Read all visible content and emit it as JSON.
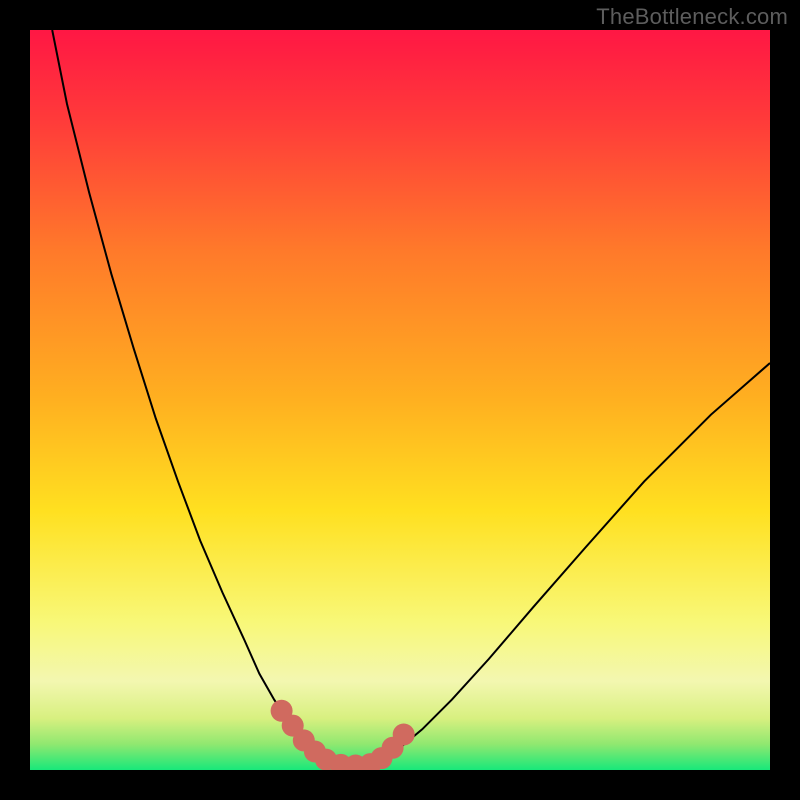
{
  "watermark": "TheBottleneck.com",
  "chart_data": {
    "type": "line",
    "title": "",
    "xlabel": "",
    "ylabel": "",
    "xlim": [
      0,
      100
    ],
    "ylim": [
      0,
      100
    ],
    "grid": false,
    "legend": false,
    "annotations": [],
    "background": {
      "type": "vertical-gradient",
      "description": "red-orange-yellow-green gradient signifying bottleneck severity (red=high, green=low)",
      "stops": [
        {
          "offset": 0.0,
          "color": "#ff1744"
        },
        {
          "offset": 0.12,
          "color": "#ff3a3a"
        },
        {
          "offset": 0.3,
          "color": "#ff7a2a"
        },
        {
          "offset": 0.5,
          "color": "#ffb020"
        },
        {
          "offset": 0.65,
          "color": "#ffe020"
        },
        {
          "offset": 0.8,
          "color": "#f8f878"
        },
        {
          "offset": 0.88,
          "color": "#f3f7b0"
        },
        {
          "offset": 0.93,
          "color": "#d8f080"
        },
        {
          "offset": 0.965,
          "color": "#90e870"
        },
        {
          "offset": 1.0,
          "color": "#18e87a"
        }
      ]
    },
    "series": [
      {
        "name": "bottleneck-curve",
        "stroke": "#000000",
        "stroke_width": 2,
        "x": [
          3,
          5,
          8,
          11,
          14,
          17,
          20,
          23,
          26,
          29,
          31,
          33,
          35,
          37,
          38.5,
          40,
          42,
          44,
          46,
          48,
          50,
          53,
          57,
          62,
          68,
          75,
          83,
          92,
          100
        ],
        "y": [
          100,
          90,
          78,
          67,
          57,
          47.5,
          39,
          31,
          24,
          17.5,
          13,
          9.5,
          6.5,
          4,
          2.5,
          1.4,
          0.7,
          0.5,
          0.7,
          1.5,
          3,
          5.5,
          9.5,
          15,
          22,
          30,
          39,
          48,
          55
        ]
      },
      {
        "name": "marker-dots",
        "type": "scatter",
        "stroke": "#d06a5f",
        "marker_size": 11,
        "x": [
          34,
          35.5,
          37,
          38.5,
          40,
          42,
          44,
          46,
          47.5,
          49,
          50.5
        ],
        "y": [
          8,
          6,
          4,
          2.5,
          1.4,
          0.7,
          0.6,
          0.8,
          1.6,
          3,
          4.8
        ]
      }
    ]
  }
}
